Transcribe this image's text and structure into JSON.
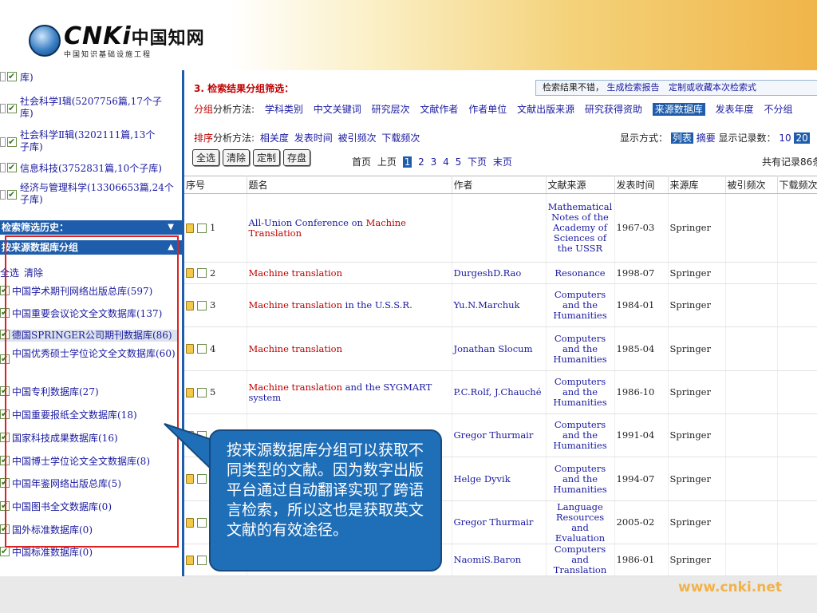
{
  "logo": {
    "name": "中国知网",
    "subtitle": "中国知识基础设施工程",
    "letters": "CNKi"
  },
  "watermark": "www.cnki.net",
  "categories": [
    {
      "label": "库)"
    },
    {
      "label": "社会科学Ⅰ辑(5207756篇,17个子库)"
    },
    {
      "label": "社会科学Ⅱ辑(3202111篇,13个子库)"
    },
    {
      "label": "信息科技(3752831篇,10个子库)"
    },
    {
      "label": "经济与管理科学(13306653篇,24个子库)"
    }
  ],
  "bars": {
    "history": "检索筛选历史：",
    "source_group": "按来源数据库分组"
  },
  "source_actions": {
    "select_all": "全选",
    "clear": "清除"
  },
  "sources": [
    {
      "label": "中国学术期刊网络出版总库(597)"
    },
    {
      "label": "中国重要会议论文全文数据库(137)"
    },
    {
      "label": "德国SPRINGER公司期刊数据库(86)"
    },
    {
      "label": "中国优秀硕士学位论文全文数据库(60)"
    },
    {
      "label": "中国专利数据库(27)"
    },
    {
      "label": "中国重要报纸全文数据库(18)"
    },
    {
      "label": "国家科技成果数据库(16)"
    },
    {
      "label": "中国博士学位论文全文数据库(8)"
    },
    {
      "label": "中国年鉴网络出版总库(5)"
    },
    {
      "label": "中国图书全文数据库(0)"
    },
    {
      "label": "国外标准数据库(0)"
    },
    {
      "label": "中国标准数据库(0)"
    }
  ],
  "main": {
    "section_title": "3. 检索结果分组筛选：",
    "unsatisfied": {
      "label": "检索结果不错，",
      "report": "生成检索报告",
      "custom": "定制或收藏本次检索式"
    },
    "group": {
      "prefix_red": "分组",
      "prefix": "分析方法:",
      "options": [
        "学科类别",
        "中文关键词",
        "研究层次",
        "文献作者",
        "作者单位",
        "文献出版来源",
        "研究获得资助"
      ],
      "selected": "来源数据库",
      "after": [
        "发表年度",
        "不分组"
      ]
    },
    "sort": {
      "prefix_red": "排序",
      "prefix": "分析方法:",
      "options": [
        "相关度",
        "发表时间",
        "被引频次",
        "下载频次"
      ]
    },
    "display": {
      "label": "显示方式：",
      "list": "列表",
      "abstract": "摘要",
      "count_label": "显示记录数：",
      "n10": "10",
      "n20": "20"
    },
    "buttons": {
      "select_all": "全选",
      "clear": "清除",
      "custom": "定制",
      "save": "存盘"
    },
    "pager": {
      "first": "首页",
      "prev": "上页",
      "current": "1",
      "pages": [
        "2",
        "3",
        "4",
        "5"
      ],
      "next": "下页",
      "last": "末页"
    },
    "total": "共有记录86条"
  },
  "table": {
    "headers": [
      "序号",
      "题名",
      "作者",
      "文献来源",
      "发表时间",
      "来源库",
      "被引频次",
      "下载频次"
    ],
    "rows": [
      {
        "n": "1",
        "title_red": "",
        "title_blue": "All-Union Conference on ",
        "title_red2": "Machine Translation",
        "author": "",
        "source": "Mathematical Notes of the Academy of Sciences of the USSR",
        "date": "1967-03",
        "db": "Springer"
      },
      {
        "n": "2",
        "title_red": "Machine translation",
        "title_blue": "",
        "title_red2": "",
        "author": "DurgeshD.Rao",
        "source": "Resonance",
        "date": "1998-07",
        "db": "Springer"
      },
      {
        "n": "3",
        "title_red": "Machine translation",
        "title_blue": " in the U.S.S.R.",
        "title_red2": "",
        "author": "Yu.N.Marchuk",
        "source": "Computers and the Humanities",
        "date": "1984-01",
        "db": "Springer"
      },
      {
        "n": "4",
        "title_red": "Machine translation",
        "title_blue": "",
        "title_red2": "",
        "author": "Jonathan Slocum",
        "source": "Computers and the Humanities",
        "date": "1985-04",
        "db": "Springer"
      },
      {
        "n": "5",
        "title_red": "Machine translation",
        "title_blue": " and the SYGMART system",
        "title_red2": "",
        "author": "P.C.Rolf, J.Chauché",
        "source": "Computers and the Humanities",
        "date": "1986-10",
        "db": "Springer"
      },
      {
        "n": "",
        "title_red": "",
        "title_blue": "",
        "title_red2": "",
        "author": "Gregor Thurmair",
        "source": "Computers and the Humanities",
        "date": "1991-04",
        "db": "Springer"
      },
      {
        "n": "",
        "title_red": "",
        "title_blue": "",
        "title_red2": "",
        "author": "Helge Dyvik",
        "source": "Computers and the Humanities",
        "date": "1994-07",
        "db": "Springer"
      },
      {
        "n": "",
        "title_red": "",
        "title_blue": "",
        "title_red2": "",
        "author": "Gregor Thurmair",
        "source": "Language Resources and Evaluation",
        "date": "2005-02",
        "db": "Springer"
      },
      {
        "n": "",
        "title_red": "",
        "title_blue": "",
        "title_red2": "",
        "author": "NaomiS.Baron",
        "source": "Computers and Translation",
        "date": "1986-01",
        "db": "Springer"
      }
    ]
  },
  "callout": "按来源数据库分组可以获取不同类型的文献。因为数字出版平台通过自动翻译实现了跨语言检索，所以这也是获取英文文献的有效途径。"
}
